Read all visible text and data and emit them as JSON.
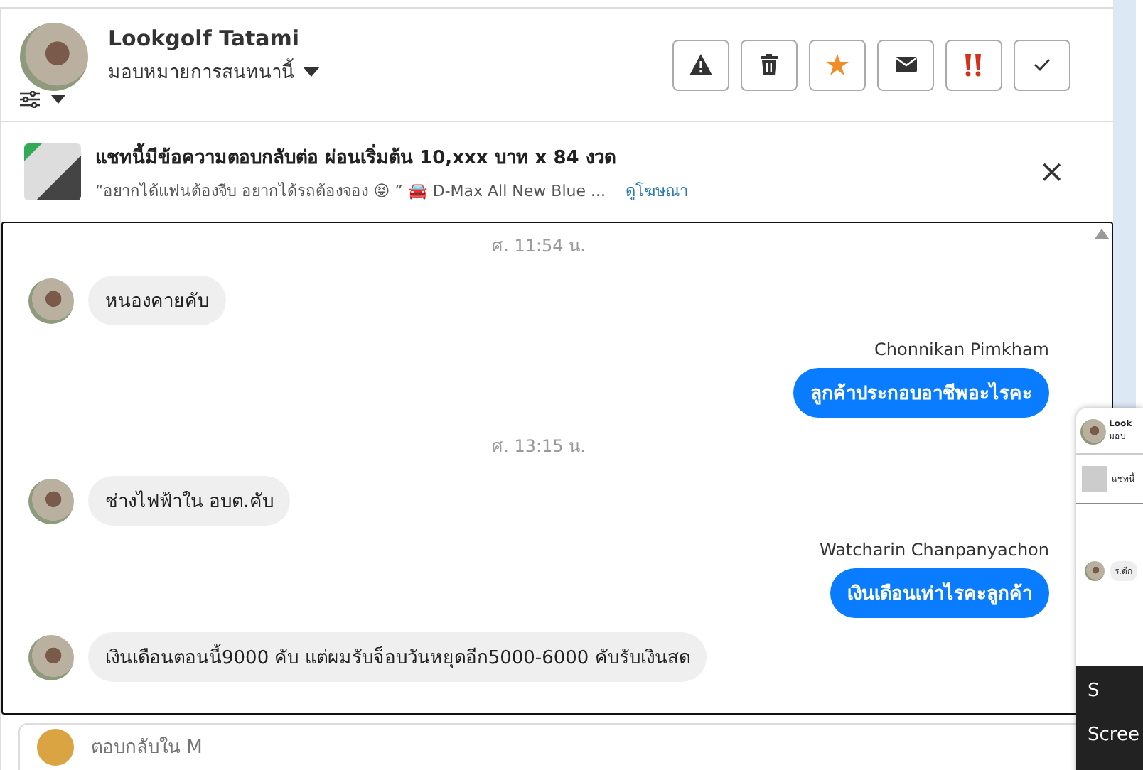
{
  "header": {
    "name": "Lookgolf Tatami",
    "assign": "มอบหมายการสนทนานี้",
    "actions": [
      {
        "kind": "warn"
      },
      {
        "kind": "trash"
      },
      {
        "kind": "star"
      },
      {
        "kind": "mail"
      },
      {
        "kind": "urgent"
      },
      {
        "kind": "check"
      }
    ]
  },
  "ad": {
    "title": "แชทนี้มีข้อความตอบกลับต่อ ผ่อนเริ่มต้น 10,xxx บาท x 84 งวด",
    "snippet": "“อยากได้แฟนต้องจีบ อยากได้รถต้องจอง 😝 ” 🚘 D-Max All New Blue ...",
    "link": "ดูโฆษณา",
    "close": "×"
  },
  "messages": [
    {
      "kind": "time",
      "text": "ศ. 11:54 น."
    },
    {
      "kind": "in",
      "text": "หนองคายคับ"
    },
    {
      "kind": "out",
      "sender": "Chonnikan Pimkham",
      "text": "ลูกค้าประกอบอาชีพอะไรคะ"
    },
    {
      "kind": "time",
      "text": "ศ. 13:15 น."
    },
    {
      "kind": "in",
      "text": "ช่างไฟฟ้าใน อบต.คับ"
    },
    {
      "kind": "out",
      "sender": "Watcharin Chanpanyachon",
      "text": "เงินเดือนเท่าไรคะลูกค้า"
    },
    {
      "kind": "in",
      "text": "เงินเดือนตอนนี้9000 คับ แต่ผมรับจ็อบวันหยุดอีก5000-6000 คับรับเงินสด"
    }
  ],
  "reply": {
    "placeholder": "ตอบกลับใน M"
  },
  "preview": {
    "name": "Look",
    "assign": "มอบ",
    "ad": "แชทนี้",
    "message": "ร.ดีก",
    "menu": [
      {
        "text": "S"
      },
      {
        "text": "Scree"
      }
    ]
  }
}
